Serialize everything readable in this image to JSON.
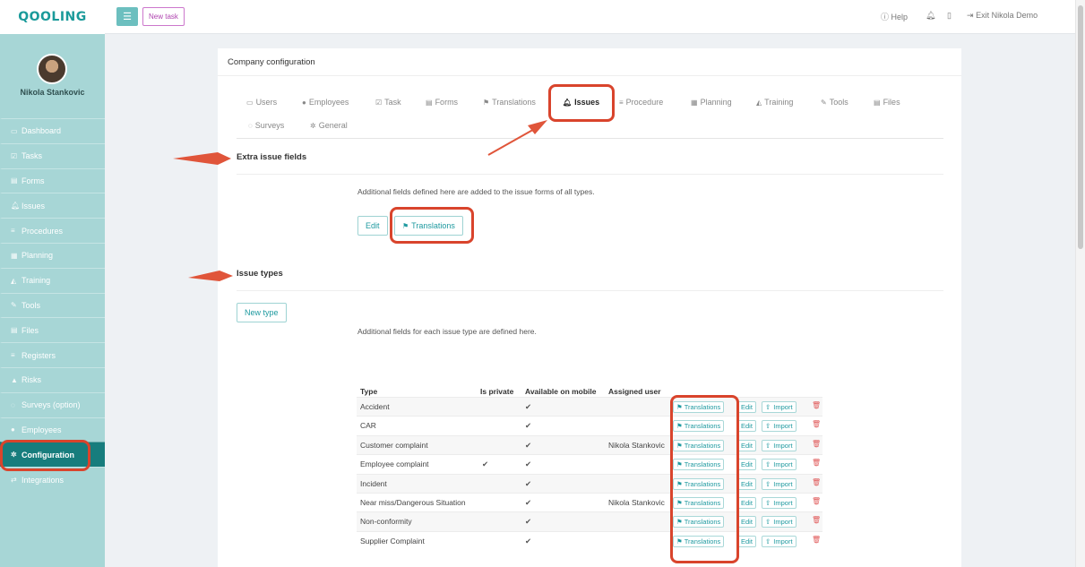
{
  "app": {
    "logo": "QOOLING",
    "user_name": "Nikola Stankovic",
    "colors": {
      "brand": "#1a9a9a",
      "sidebar": "#a7d6d6",
      "active_nav": "#177d7d",
      "annotation": "#d9442c"
    }
  },
  "topbar": {
    "menu_icon": "menu-icon",
    "new_task": "New task",
    "help": "Help",
    "exit": "Exit Nikola Demo"
  },
  "sidebar": {
    "items": [
      {
        "label": "Dashboard",
        "icon": "monitor-icon"
      },
      {
        "label": "Tasks",
        "icon": "checkbox-icon"
      },
      {
        "label": "Forms",
        "icon": "file-icon"
      },
      {
        "label": "Issues",
        "icon": "bell-icon"
      },
      {
        "label": "Procedures",
        "icon": "list-icon"
      },
      {
        "label": "Planning",
        "icon": "calendar-icon"
      },
      {
        "label": "Training",
        "icon": "graduation-icon"
      },
      {
        "label": "Tools",
        "icon": "wrench-icon"
      },
      {
        "label": "Files",
        "icon": "file-icon"
      },
      {
        "label": "Registers",
        "icon": "list-icon"
      },
      {
        "label": "Risks",
        "icon": "warning-icon"
      },
      {
        "label": "Surveys (option)",
        "icon": "comment-icon"
      },
      {
        "label": "Employees",
        "icon": "users-icon"
      },
      {
        "label": "Configuration",
        "icon": "gear-icon",
        "active": true
      },
      {
        "label": "Integrations",
        "icon": "exchange-icon"
      }
    ]
  },
  "panel": {
    "title": "Company configuration",
    "tabs": [
      {
        "label": "Users",
        "icon": "id-card-icon"
      },
      {
        "label": "Employees",
        "icon": "users-icon"
      },
      {
        "label": "Task",
        "icon": "checkbox-icon"
      },
      {
        "label": "Forms",
        "icon": "file-icon"
      },
      {
        "label": "Translations",
        "icon": "language-icon"
      },
      {
        "label": "Issues",
        "icon": "bell-icon",
        "active": true
      },
      {
        "label": "Procedure",
        "icon": "list-icon"
      },
      {
        "label": "Planning",
        "icon": "calendar-icon"
      },
      {
        "label": "Training",
        "icon": "graduation-icon"
      },
      {
        "label": "Tools",
        "icon": "wrench-icon"
      },
      {
        "label": "Files",
        "icon": "file-icon"
      },
      {
        "label": "Surveys",
        "icon": "comment-icon"
      },
      {
        "label": "General",
        "icon": "gear-icon"
      }
    ],
    "extra_fields": {
      "title": "Extra issue fields",
      "description": "Additional fields defined here are added to the issue forms of all types.",
      "edit": "Edit",
      "translations": "Translations"
    },
    "issue_types": {
      "title": "Issue types",
      "new_type": "New type",
      "description": "Additional fields for each issue type are defined here.",
      "columns": [
        "Type",
        "Is private",
        "Available on mobile",
        "Assigned user"
      ],
      "row_buttons": {
        "translations": "Translations",
        "edit": "Edit",
        "import": "Import"
      },
      "rows": [
        {
          "type": "Accident",
          "is_private": false,
          "mobile": true,
          "user": ""
        },
        {
          "type": "CAR",
          "is_private": false,
          "mobile": true,
          "user": ""
        },
        {
          "type": "Customer complaint",
          "is_private": false,
          "mobile": true,
          "user": "Nikola Stankovic"
        },
        {
          "type": "Employee complaint",
          "is_private": true,
          "mobile": true,
          "user": ""
        },
        {
          "type": "Incident",
          "is_private": false,
          "mobile": true,
          "user": ""
        },
        {
          "type": "Near miss/Dangerous Situation",
          "is_private": false,
          "mobile": true,
          "user": "Nikola Stankovic"
        },
        {
          "type": "Non-conformity",
          "is_private": false,
          "mobile": true,
          "user": ""
        },
        {
          "type": "Supplier Complaint",
          "is_private": false,
          "mobile": true,
          "user": ""
        }
      ]
    }
  }
}
